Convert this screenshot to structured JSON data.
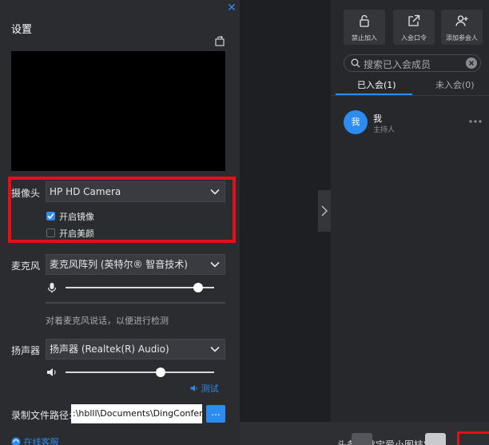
{
  "settings": {
    "title": "设置",
    "camera": {
      "label": "摄像头",
      "value": "HP HD Camera"
    },
    "mirror": {
      "label": "开启镜像",
      "checked": true
    },
    "beauty": {
      "label": "开启美颜",
      "checked": false
    },
    "microphone": {
      "label": "麦克风",
      "value": "麦克风阵列 (英特尔® 智音技术)",
      "level": 0.89,
      "hint": "对着麦克风说话，以便进行检测"
    },
    "speaker": {
      "label": "扬声器",
      "value": "扬声器 (Realtek(R) Audio)",
      "level": 0.64,
      "test_label": "测试"
    },
    "record_path": {
      "label": "录制文件路径:",
      "value": ":\\hblll\\Documents\\DingConference",
      "browse_label": "..."
    },
    "online_support": "在线客服"
  },
  "toolbar": {
    "buttons": [
      {
        "label": "禁止加入",
        "icon": "lock-icon"
      },
      {
        "label": "入会口令",
        "icon": "share-icon"
      },
      {
        "label": "添加参会人",
        "icon": "add-user-icon"
      }
    ]
  },
  "search": {
    "placeholder": "搜索已入会成员"
  },
  "tabs": [
    {
      "label": "已入会(1)",
      "active": true
    },
    {
      "label": "未入会(0)",
      "active": false
    }
  ],
  "members": [
    {
      "avatar": "我",
      "name": "我",
      "role": "主持人"
    }
  ],
  "bottom_bar": {
    "text": "头条@桃宝爱小图桔农"
  },
  "colors": {
    "accent": "#2d8cf0",
    "highlight": "#e3101a",
    "panel": "#2b2c30",
    "background": "#1e1f22"
  }
}
